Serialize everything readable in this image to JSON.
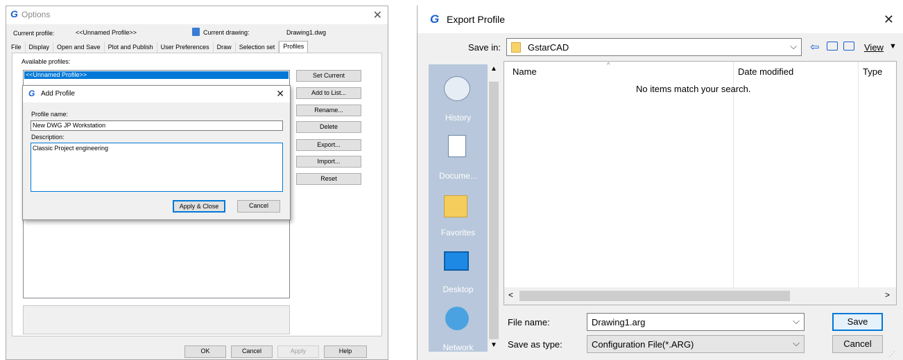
{
  "options": {
    "title": "Options",
    "current_profile_label": "Current profile:",
    "current_profile_value": "<<Unnamed Profile>>",
    "current_drawing_label": "Current drawing:",
    "current_drawing_value": "Drawing1.dwg",
    "tabs": [
      "File",
      "Display",
      "Open and Save",
      "Plot and Publish",
      "User Preferences",
      "Draw",
      "Selection set",
      "Profiles"
    ],
    "available_profiles_label": "Available profiles:",
    "profiles": [
      "<<Unnamed Profile>>"
    ],
    "side_buttons": [
      "Set Current",
      "Add to List...",
      "Rename...",
      "Delete",
      "Export...",
      "Import...",
      "Reset"
    ],
    "bottom_buttons": {
      "ok": "OK",
      "cancel": "Cancel",
      "apply": "Apply",
      "help": "Help"
    }
  },
  "add_profile": {
    "title": "Add Profile",
    "profile_name_label": "Profile name:",
    "profile_name_value": "New DWG JP Workstation",
    "description_label": "Description:",
    "description_value": "Classic Project engineering",
    "apply_close": "Apply & Close",
    "cancel": "Cancel"
  },
  "export": {
    "title": "Export Profile",
    "save_in_label": "Save in:",
    "save_in_value": "GstarCAD",
    "view_label": "View",
    "places": [
      "History",
      "Docume...",
      "Favorites",
      "Desktop",
      "Network"
    ],
    "columns": [
      "Name",
      "Date modified",
      "Type"
    ],
    "empty_message": "No items match your search.",
    "file_name_label": "File name:",
    "file_name_value": "Drawing1.arg",
    "save_as_type_label": "Save as type:",
    "save_as_type_value": "Configuration File(*.ARG)",
    "save_button": "Save",
    "cancel_button": "Cancel"
  },
  "colors": {
    "accent": "#0078d7",
    "brand": "#1a5fd0",
    "places_bg": "#b8c7db"
  }
}
